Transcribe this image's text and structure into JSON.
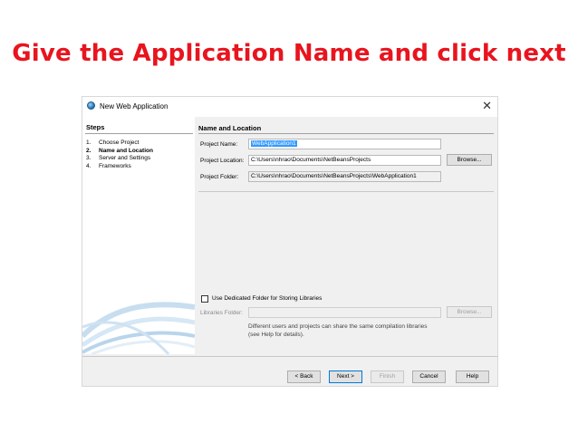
{
  "slide": {
    "title": "Give the Application Name and click next"
  },
  "dialog": {
    "title": "New Web Application",
    "close_glyph": "✕",
    "steps": {
      "header": "Steps",
      "items": [
        {
          "num": "1.",
          "label": "Choose Project",
          "active": false
        },
        {
          "num": "2.",
          "label": "Name and Location",
          "active": true
        },
        {
          "num": "3.",
          "label": "Server and Settings",
          "active": false
        },
        {
          "num": "4.",
          "label": "Frameworks",
          "active": false
        }
      ]
    },
    "section_header": "Name and Location",
    "fields": {
      "project_name": {
        "label": "Project Name:",
        "value": "WebApplication1"
      },
      "project_location": {
        "label": "Project Location:",
        "value": "C:\\Users\\nhrao\\Documents\\NetBeansProjects"
      },
      "project_folder": {
        "label": "Project Folder:",
        "value": "C:\\Users\\nhrao\\Documents\\NetBeansProjects\\WebApplication1"
      },
      "libraries_folder": {
        "label": "Libraries Folder:",
        "value": ""
      }
    },
    "browse_label": "Browse...",
    "dedicated_folder_checkbox": {
      "label": "Use Dedicated Folder for Storing Libraries",
      "checked": false
    },
    "help_text": {
      "line1": "Different users and projects can share the same compilation libraries",
      "line2": "(see Help for details)."
    },
    "buttons": {
      "back": "< Back",
      "next": "Next >",
      "finish": "Finish",
      "cancel": "Cancel",
      "help": "Help"
    }
  },
  "colors": {
    "title_red": "#e8141e",
    "selection_blue": "#3399ff",
    "default_button_border": "#0078d7"
  },
  "icons": {
    "app": "netbeans-icon",
    "close": "close-icon"
  }
}
